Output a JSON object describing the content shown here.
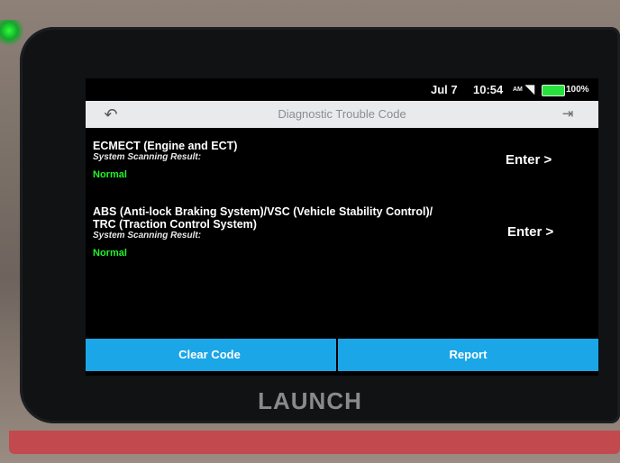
{
  "statusbar": {
    "date": "Jul 7",
    "time": "10:54",
    "ampm": "AM",
    "battery_percent": "100%"
  },
  "titlebar": {
    "title": "Diagnostic Trouble Code"
  },
  "systems": [
    {
      "name_line1": "ECMECT (Engine and ECT)",
      "name_line2": "",
      "scan_label": "System Scanning Result:",
      "status": "Normal",
      "enter_label": "Enter >"
    },
    {
      "name_line1": "ABS (Anti-lock Braking System)/VSC (Vehicle Stability Control)/",
      "name_line2": "TRC (Traction Control System)",
      "scan_label": "System Scanning Result:",
      "status": "Normal",
      "enter_label": "Enter >"
    }
  ],
  "buttons": {
    "clear_code": "Clear Code",
    "report": "Report"
  },
  "device": {
    "brand": "LAUNCH"
  },
  "colors": {
    "accent": "#1BA6E8",
    "status_normal": "#22F22B",
    "battery": "#27E23C"
  },
  "icons": {
    "back": "back-arrow-icon",
    "exit": "exit-icon",
    "wifi": "wifi-icon",
    "battery": "battery-icon"
  }
}
